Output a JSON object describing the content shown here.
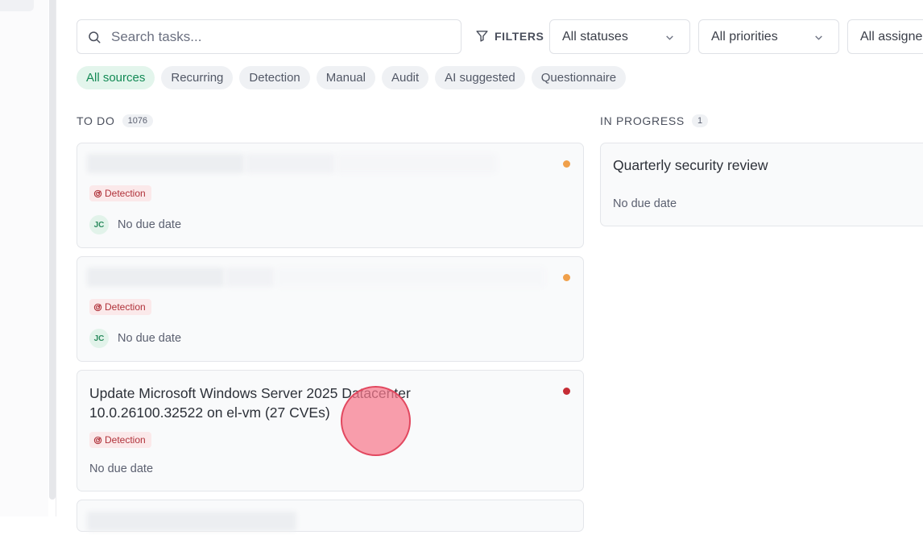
{
  "toolbar": {
    "search_placeholder": "Search tasks...",
    "filters_label": "FILTERS",
    "status_select": "All statuses",
    "priority_select": "All priorities",
    "assignee_select": "All assignees"
  },
  "sources": [
    "All sources",
    "Recurring",
    "Detection",
    "Manual",
    "Audit",
    "AI suggested",
    "Questionnaire"
  ],
  "columns": {
    "todo": {
      "label": "TO DO",
      "count": "1076",
      "cards": [
        {
          "title": "",
          "tag": "Detection",
          "assignee": "JC",
          "due": "No due date",
          "priority_color": "#f0a04b"
        },
        {
          "title": "",
          "tag": "Detection",
          "assignee": "JC",
          "due": "No due date",
          "priority_color": "#f0a04b"
        },
        {
          "title": "Update Microsoft Windows Server 2025 Datacenter 10.0.26100.32522 on el-vm (27 CVEs)",
          "tag": "Detection",
          "due": "No due date",
          "priority_color": "#c62d35"
        }
      ]
    },
    "in_progress": {
      "label": "IN PROGRESS",
      "count": "1",
      "cards": [
        {
          "title": "Quarterly security review",
          "due": "No due date"
        }
      ]
    }
  },
  "colors": {
    "accent_green": "#138a55",
    "detection_red": "#b0323a",
    "cursor": "#e2485f"
  }
}
